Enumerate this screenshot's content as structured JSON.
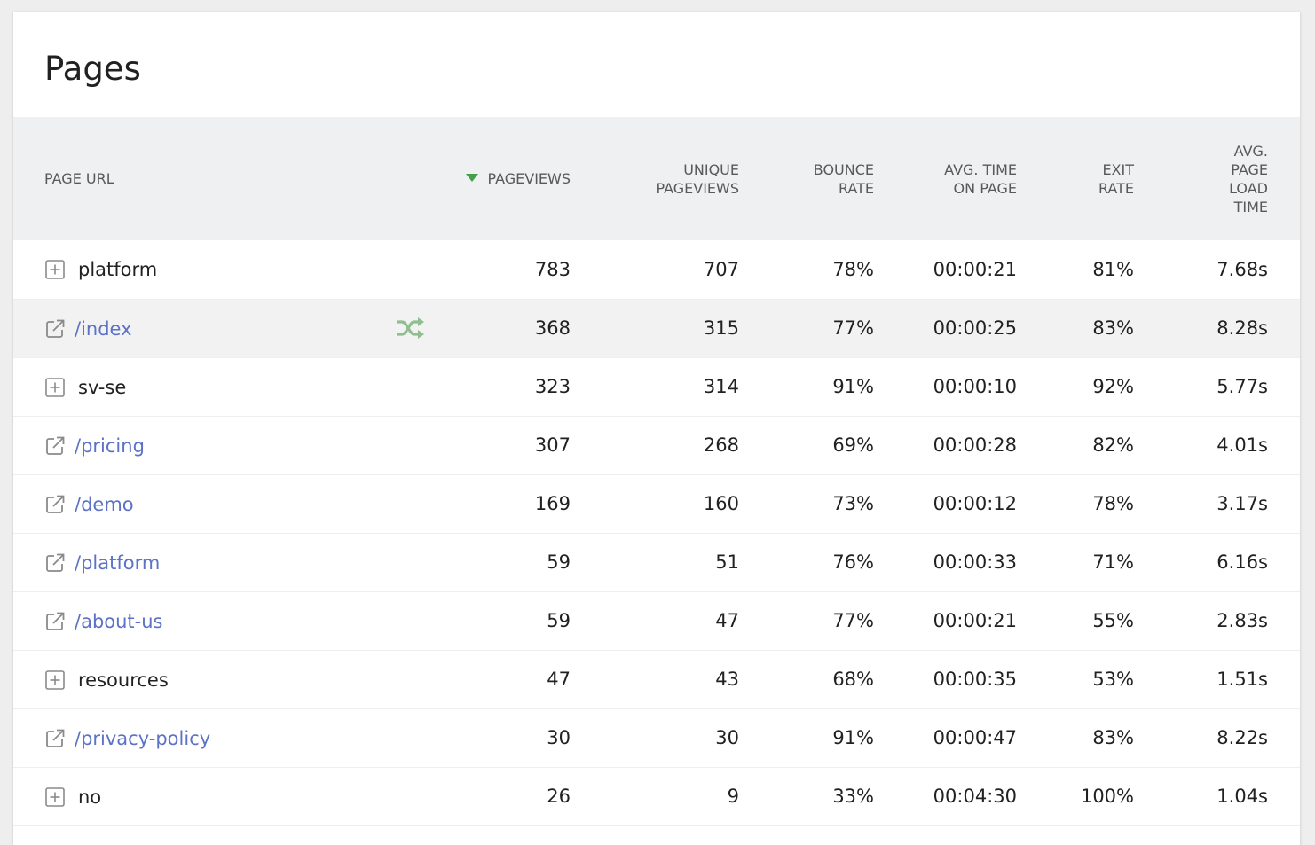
{
  "title": "Pages",
  "colors": {
    "link": "#5b72c7",
    "sort_indicator": "#43a047",
    "segmented_icon": "#8fbf8f",
    "header_bg": "#eef0f1"
  },
  "columns": [
    {
      "key": "label",
      "lines": [
        "PAGE URL"
      ]
    },
    {
      "key": "pageviews",
      "lines": [
        "PAGEVIEWS"
      ],
      "sorted": "desc"
    },
    {
      "key": "unique",
      "lines": [
        "UNIQUE",
        "PAGEVIEWS"
      ]
    },
    {
      "key": "bounce",
      "lines": [
        "BOUNCE",
        "RATE"
      ]
    },
    {
      "key": "time",
      "lines": [
        "AVG. TIME",
        "ON PAGE"
      ]
    },
    {
      "key": "exit",
      "lines": [
        "EXIT",
        "RATE"
      ]
    },
    {
      "key": "load",
      "lines": [
        "AVG.",
        "PAGE",
        "LOAD",
        "TIME"
      ]
    }
  ],
  "rows": [
    {
      "type": "folder",
      "icon": "plus-square-icon",
      "label": "platform",
      "pageviews": "783",
      "unique": "707",
      "bounce": "78%",
      "time": "00:00:21",
      "exit": "81%",
      "load": "7.68s"
    },
    {
      "type": "page",
      "icon": "external-link-icon",
      "label": "/index",
      "pageviews": "368",
      "unique": "315",
      "bounce": "77%",
      "time": "00:00:25",
      "exit": "83%",
      "load": "8.28s",
      "hover": true,
      "segmented_visitor_log_icon": "shuffle-icon"
    },
    {
      "type": "folder",
      "icon": "plus-square-icon",
      "label": "sv-se",
      "pageviews": "323",
      "unique": "314",
      "bounce": "91%",
      "time": "00:00:10",
      "exit": "92%",
      "load": "5.77s"
    },
    {
      "type": "page",
      "icon": "external-link-icon",
      "label": "/pricing",
      "pageviews": "307",
      "unique": "268",
      "bounce": "69%",
      "time": "00:00:28",
      "exit": "82%",
      "load": "4.01s"
    },
    {
      "type": "page",
      "icon": "external-link-icon",
      "label": "/demo",
      "pageviews": "169",
      "unique": "160",
      "bounce": "73%",
      "time": "00:00:12",
      "exit": "78%",
      "load": "3.17s"
    },
    {
      "type": "page",
      "icon": "external-link-icon",
      "label": "/platform",
      "pageviews": "59",
      "unique": "51",
      "bounce": "76%",
      "time": "00:00:33",
      "exit": "71%",
      "load": "6.16s"
    },
    {
      "type": "page",
      "icon": "external-link-icon",
      "label": "/about-us",
      "pageviews": "59",
      "unique": "47",
      "bounce": "77%",
      "time": "00:00:21",
      "exit": "55%",
      "load": "2.83s"
    },
    {
      "type": "folder",
      "icon": "plus-square-icon",
      "label": "resources",
      "pageviews": "47",
      "unique": "43",
      "bounce": "68%",
      "time": "00:00:35",
      "exit": "53%",
      "load": "1.51s"
    },
    {
      "type": "page",
      "icon": "external-link-icon",
      "label": "/privacy-policy",
      "pageviews": "30",
      "unique": "30",
      "bounce": "91%",
      "time": "00:00:47",
      "exit": "83%",
      "load": "8.22s"
    },
    {
      "type": "folder",
      "icon": "plus-square-icon",
      "label": "no",
      "pageviews": "26",
      "unique": "9",
      "bounce": "33%",
      "time": "00:04:30",
      "exit": "100%",
      "load": "1.04s"
    }
  ]
}
